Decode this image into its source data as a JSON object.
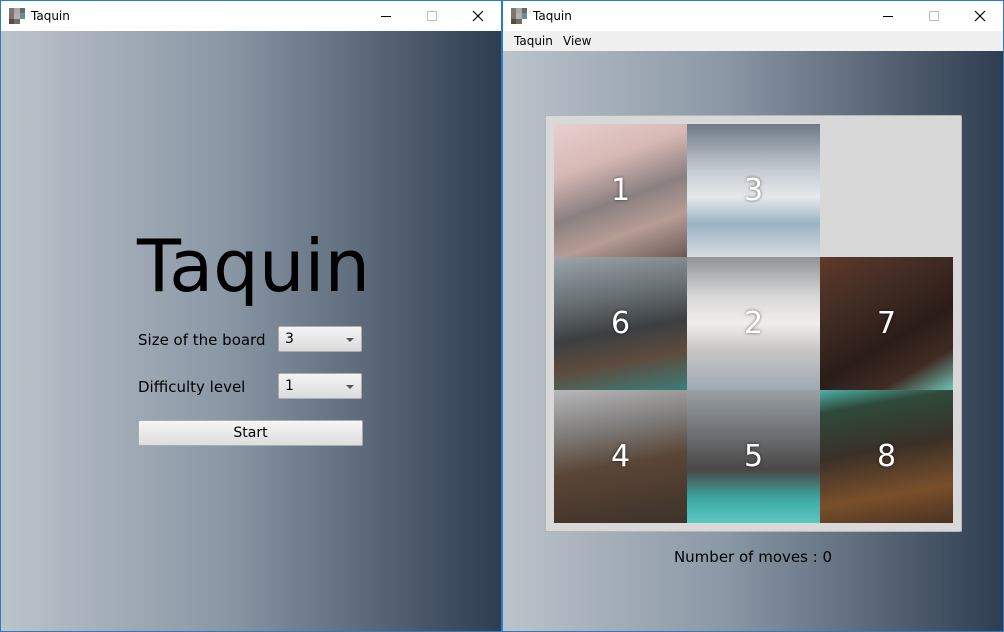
{
  "left_window": {
    "title": "Taquin",
    "heading": "Taquin",
    "board_size": {
      "label": "Size of the board",
      "value": "3"
    },
    "difficulty": {
      "label": "Difficulty level",
      "value": "1"
    },
    "start_label": "Start"
  },
  "right_window": {
    "title": "Taquin",
    "menu": [
      "Taquin",
      "View"
    ],
    "tiles": [
      "1",
      "3",
      "6",
      "2",
      "7",
      "4",
      "5",
      "8"
    ],
    "moves_text": "Number of moves : 0"
  },
  "colors": {
    "window_border": "#2b7bc6",
    "gradient_light": "#bcc3cb",
    "gradient_dark": "#2e3d50"
  }
}
